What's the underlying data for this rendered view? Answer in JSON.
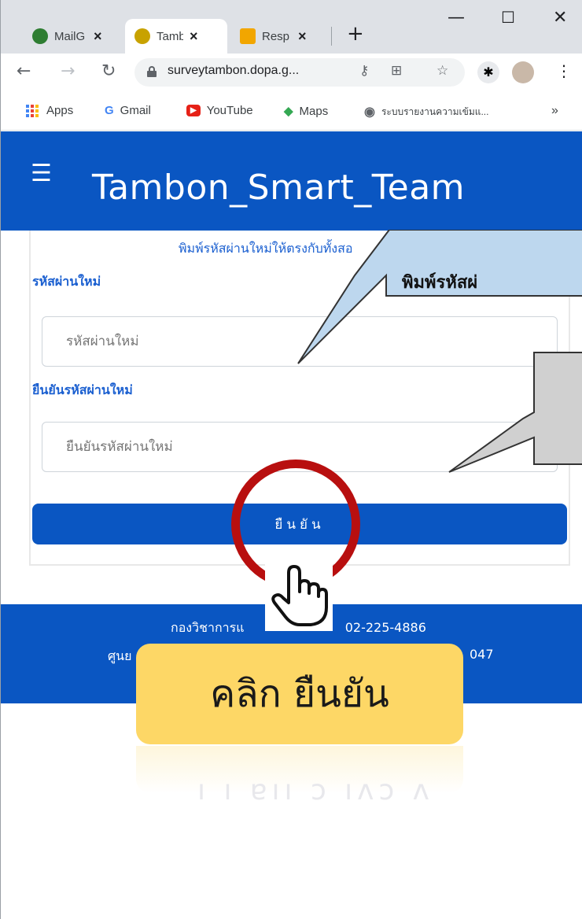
{
  "browser": {
    "tabs": [
      {
        "title": "MailG",
        "icon": "mail-icon",
        "color": "#2e7d32"
      },
      {
        "title": "Tambon",
        "icon": "dopa-seal-icon",
        "color": "#c8a200"
      },
      {
        "title": "Resp",
        "icon": "forms-icon",
        "color": "#f2a600"
      }
    ],
    "url": "surveytambon.dopa.g...",
    "bookmarks": [
      {
        "label": "Apps",
        "icon": "apps-grid-icon"
      },
      {
        "label": "Gmail",
        "icon": "google-icon"
      },
      {
        "label": "YouTube",
        "icon": "youtube-icon"
      },
      {
        "label": "Maps",
        "icon": "maps-icon"
      },
      {
        "label": "ระบบรายงานความเข้มแ...",
        "icon": "globe-icon"
      }
    ],
    "more_bookmarks": "»"
  },
  "site": {
    "title": "Tambon_Smart_Team",
    "form": {
      "hint": "พิมพ์รหัสผ่านใหม่ให้ตรงกับทั้งสอ",
      "new_password_label": "รหัสผ่านใหม่",
      "new_password_placeholder": "รหัสผ่านใหม่",
      "confirm_password_label": "ยืนยันรหัสผ่านใหม่",
      "confirm_password_placeholder": "ยืนยันรหัสผ่านใหม่",
      "submit_label": "ยืนยัน"
    },
    "footer": {
      "line1_left": "กองวิชาการแ",
      "line1_right": "02-225-4886",
      "line2_left": "ศูนย",
      "line2_right": "047"
    }
  },
  "annotation": {
    "callout_text": "พิมพ์รหัสผ่",
    "click_label": "คลิก ยืนยัน",
    "callout_colors": {
      "primary": "#bdd7ee",
      "secondary": "#d0d0d0",
      "ring": "#b80f0f",
      "label_bg": "#fdd766"
    }
  }
}
